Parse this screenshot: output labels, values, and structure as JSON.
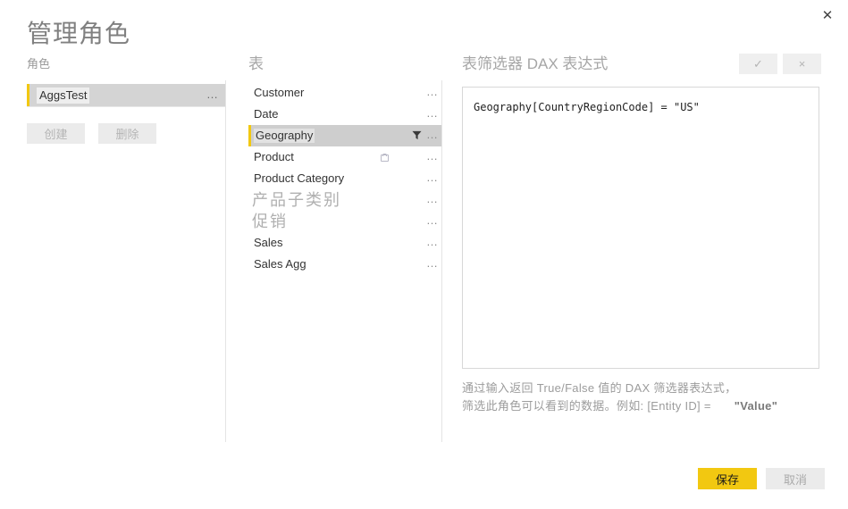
{
  "dialog": {
    "title": "管理角色",
    "close_icon": "close-icon",
    "close_label": "✕"
  },
  "roles_panel": {
    "heading": "角色",
    "items": [
      {
        "name": "AggsTest",
        "selected": true,
        "ellipsis": "…"
      }
    ],
    "create_label": "创建",
    "delete_label": "删除"
  },
  "tables_panel": {
    "heading": "表",
    "ellipsis": "…",
    "items": [
      {
        "name": "Customer",
        "selected": false,
        "cjk_big": false,
        "filtered": false,
        "mini_icon": false
      },
      {
        "name": "Date",
        "selected": false,
        "cjk_big": false,
        "filtered": false,
        "mini_icon": false
      },
      {
        "name": "Geography",
        "selected": true,
        "cjk_big": false,
        "filtered": true,
        "mini_icon": false
      },
      {
        "name": "Product",
        "selected": false,
        "cjk_big": false,
        "filtered": false,
        "mini_icon": true
      },
      {
        "name": "Product Category",
        "selected": false,
        "cjk_big": false,
        "filtered": false,
        "mini_icon": false
      },
      {
        "name": "产品子类别",
        "selected": false,
        "cjk_big": true,
        "filtered": false,
        "mini_icon": false
      },
      {
        "name": "促销",
        "selected": false,
        "cjk_big": true,
        "filtered": false,
        "mini_icon": false
      },
      {
        "name": "Sales",
        "selected": false,
        "cjk_big": false,
        "filtered": false,
        "mini_icon": false
      },
      {
        "name": "Sales Agg",
        "selected": false,
        "cjk_big": false,
        "filtered": false,
        "mini_icon": false
      }
    ]
  },
  "dax_panel": {
    "heading": "表筛选器 DAX 表达式",
    "accept_label": "✓",
    "reject_label": "×",
    "expression": "Geography[CountryRegionCode] = \"US\"",
    "hint_line1": "通过输入返回 True/False 值的 DAX 筛选器表达式，",
    "hint_line2": "筛选此角色可以看到的数据。例如: [Entity ID] =",
    "hint_value": "\"Value\""
  },
  "footer": {
    "save_label": "保存",
    "cancel_label": "取消"
  },
  "colors": {
    "accent_yellow": "#f2c811",
    "selected_row": "#cecece",
    "role_row": "#d4d4d4",
    "divider": "#e4e4e4",
    "muted_text": "#9a9a9a"
  }
}
